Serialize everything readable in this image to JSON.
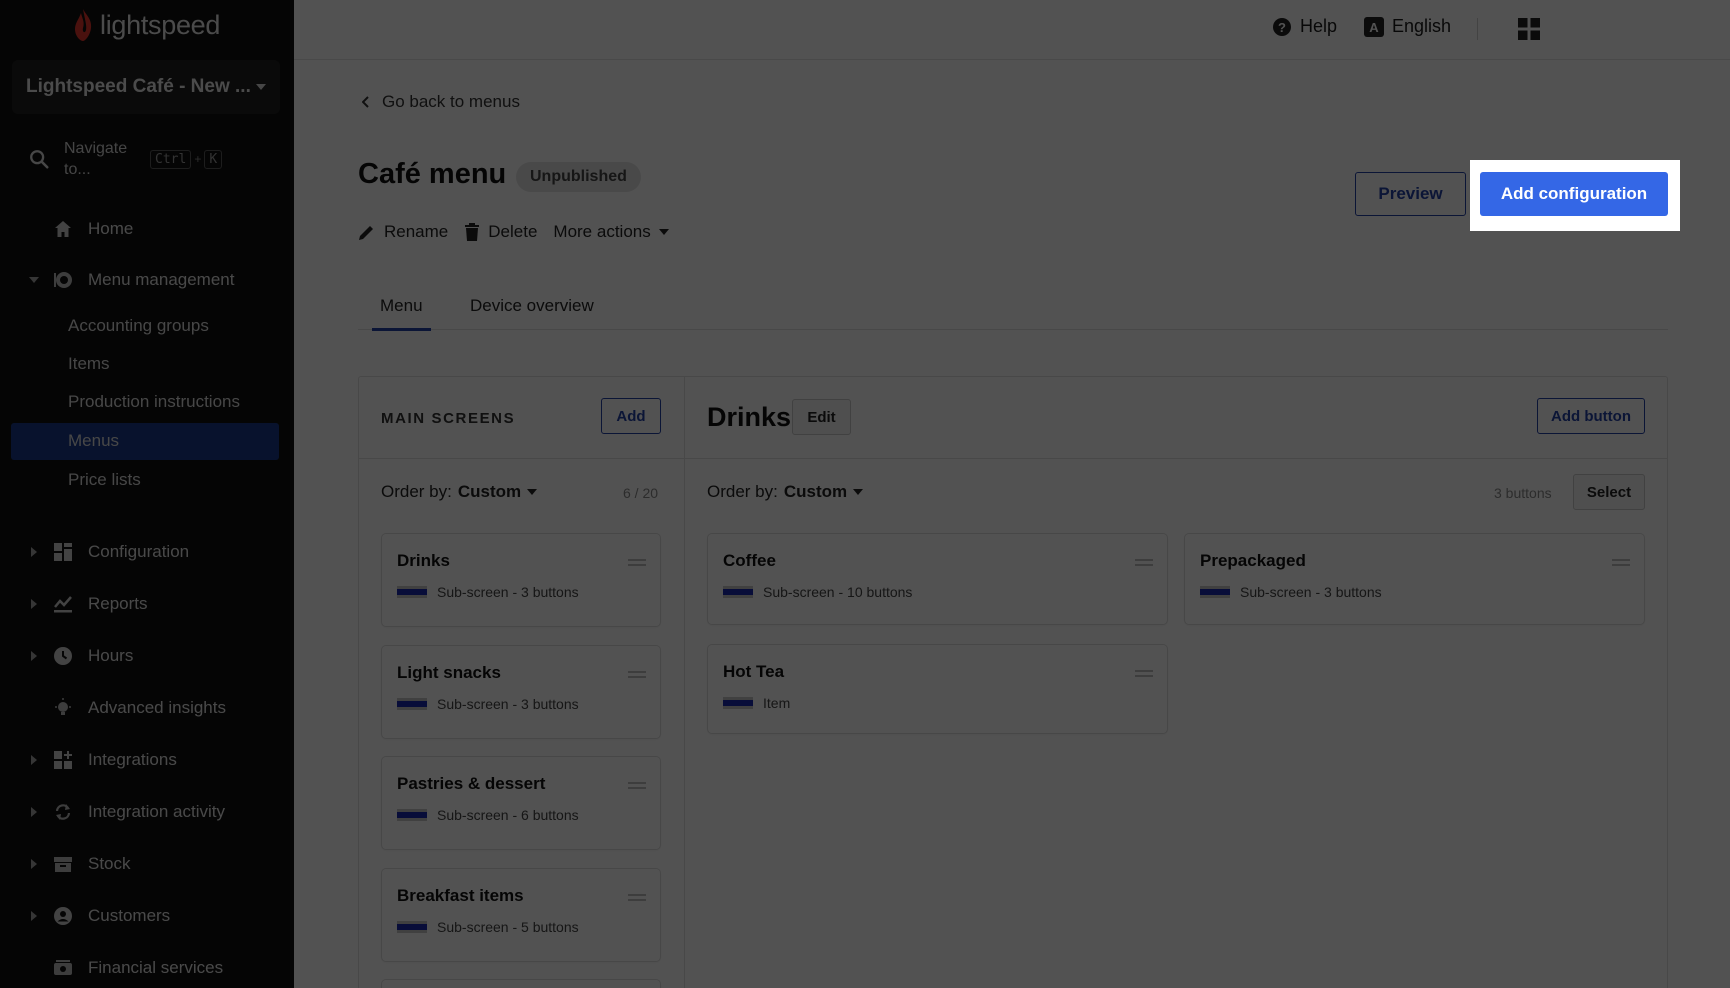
{
  "brand": {
    "logo_text": "lightspeed",
    "accent": "#3467e6",
    "sidebar_active": "#1a3a8c"
  },
  "sidebar": {
    "location": "Lightspeed Café - New ...",
    "search": {
      "label": "Navigate to...",
      "keys": [
        "Ctrl",
        "+",
        "K"
      ]
    },
    "items": [
      {
        "label": "Home",
        "icon": "home-icon"
      },
      {
        "label": "Menu management",
        "icon": "menu-management-icon"
      },
      {
        "label": "Configuration",
        "icon": "configuration-icon"
      },
      {
        "label": "Reports",
        "icon": "reports-icon"
      },
      {
        "label": "Hours",
        "icon": "clock-icon"
      },
      {
        "label": "Advanced insights",
        "icon": "lightbulb-icon"
      },
      {
        "label": "Integrations",
        "icon": "integrations-icon"
      },
      {
        "label": "Integration activity",
        "icon": "sync-icon"
      },
      {
        "label": "Stock",
        "icon": "stock-icon"
      },
      {
        "label": "Customers",
        "icon": "customer-icon"
      },
      {
        "label": "Financial services",
        "icon": "financial-icon"
      }
    ],
    "sub_items": [
      "Accounting groups",
      "Items",
      "Production instructions",
      "Menus",
      "Price lists"
    ],
    "active_sub": "Menus"
  },
  "topbar": {
    "help": "Help",
    "language": "English"
  },
  "page": {
    "back": "Go back to menus",
    "title": "Café menu",
    "status": "Unpublished",
    "actions": {
      "rename": "Rename",
      "delete": "Delete",
      "more": "More actions"
    },
    "preview": "Preview",
    "add_configuration": "Add configuration",
    "tabs": [
      "Menu",
      "Device overview"
    ]
  },
  "main_screens": {
    "label": "MAIN SCREENS",
    "add": "Add",
    "order_prefix": "Order by:",
    "order_value": "Custom",
    "count": "6 / 20",
    "cards": [
      {
        "title": "Drinks",
        "sub": "Sub-screen - 3 buttons"
      },
      {
        "title": "Light snacks",
        "sub": "Sub-screen - 3 buttons"
      },
      {
        "title": "Pastries & dessert",
        "sub": "Sub-screen - 6 buttons"
      },
      {
        "title": "Breakfast items",
        "sub": "Sub-screen - 5 buttons"
      }
    ]
  },
  "screen": {
    "title": "Drinks",
    "edit": "Edit",
    "add_button": "Add button",
    "order_prefix": "Order by:",
    "order_value": "Custom",
    "count": "3 buttons",
    "select": "Select",
    "buttons": [
      {
        "title": "Coffee",
        "sub": "Sub-screen - 10 buttons"
      },
      {
        "title": "Prepackaged",
        "sub": "Sub-screen - 3 buttons"
      },
      {
        "title": "Hot Tea",
        "sub": "Item"
      }
    ]
  }
}
